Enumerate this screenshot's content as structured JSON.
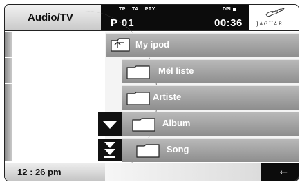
{
  "header": {
    "app_title": "Audio/TV",
    "flags": [
      "TP",
      "TA",
      "PTY"
    ],
    "dpl_label": "DPL",
    "preset": "P  01",
    "time": "00:36",
    "brand": "JAGUAR"
  },
  "browser": {
    "items": [
      {
        "label": "My ipod",
        "icon": "folder-up-icon"
      },
      {
        "label": "Mél liste",
        "icon": "folder-icon"
      },
      {
        "label": "Artiste",
        "icon": "folder-icon"
      },
      {
        "label": "Album",
        "icon": "folder-icon"
      },
      {
        "label": "Song",
        "icon": "folder-icon"
      }
    ],
    "scroll_buttons": [
      "scroll-down-icon",
      "scroll-page-down-icon"
    ]
  },
  "footer": {
    "clock": "12 : 26 pm",
    "back_icon": "back-arrow-icon"
  },
  "colors": {
    "header_dark": "#0c0c0c",
    "row_grey": "#a3a3a3"
  }
}
